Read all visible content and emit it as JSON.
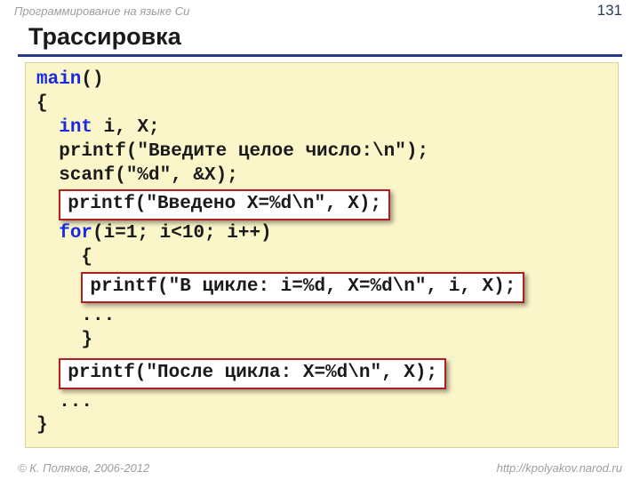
{
  "header": {
    "course": "Программирование на языке Си",
    "page": "131"
  },
  "title": "Трассировка",
  "code": {
    "l1a": "main",
    "l1b": "()",
    "l2": "{",
    "l3a": "  ",
    "l3b": "int",
    "l3c": " i, X;",
    "l4": "  printf(\"Введите целое число:\\n\");",
    "l5": "  scanf(\"%d\", &X);",
    "hl1": "printf(\"Введено X=%d\\n\", X);",
    "l7a": "  ",
    "l7b": "for",
    "l7c": "(i=1; i<10; i++)",
    "l8": "    {",
    "hl2": "printf(\"В цикле: i=%d, X=%d\\n\", i, X);",
    "l10": "    ...",
    "l11": "    }",
    "hl3": "printf(\"После цикла: X=%d\\n\", X);",
    "l13": "  ...",
    "l14": "}"
  },
  "footer": {
    "copyright": "© К. Поляков, 2006-2012",
    "url": "http://kpolyakov.narod.ru"
  }
}
